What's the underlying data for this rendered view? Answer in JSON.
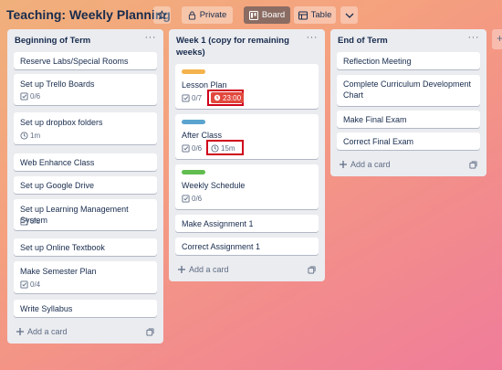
{
  "board": {
    "title": "Teaching: Weekly Planning",
    "visibility": "Private",
    "views": [
      {
        "label": "Board"
      },
      {
        "label": "Table"
      }
    ]
  },
  "lists": [
    {
      "title": "Beginning of Term",
      "cards": [
        {
          "title": "Reserve Labs/Special Rooms"
        },
        {
          "title": "Set up Trello Boards",
          "checklist": "0/6"
        },
        {
          "title": "Set up dropbox folders",
          "time": "1m"
        },
        {
          "title": "Web Enhance Class"
        },
        {
          "title": "Set up Google Drive"
        },
        {
          "title": "Set up Learning Management System",
          "checklist": "0/3"
        },
        {
          "title": "Set up Online Textbook"
        },
        {
          "title": "Make Semester Plan",
          "checklist": "0/4"
        },
        {
          "title": "Write Syllabus"
        }
      ],
      "add_label": "Add a card"
    },
    {
      "title": "Week 1 (copy for remaining weeks)",
      "cards": [
        {
          "title": "Lesson Plan",
          "label_color": "#f5b34d",
          "checklist": "0/7",
          "due": "23:00"
        },
        {
          "title": "After Class",
          "label_color": "#5ba4cf",
          "checklist": "0/6",
          "time": "15m"
        },
        {
          "title": "Weekly Schedule",
          "label_color": "#61bd4f",
          "checklist": "0/6"
        },
        {
          "title": "Make Assignment 1"
        },
        {
          "title": "Correct Assignment 1"
        }
      ],
      "add_label": "Add a card"
    },
    {
      "title": "End of Term",
      "cards": [
        {
          "title": "Reflection Meeting"
        },
        {
          "title": "Complete Curriculum Development Chart"
        },
        {
          "title": "Make Final Exam"
        },
        {
          "title": "Correct Final Exam"
        }
      ],
      "add_label": "Add a card"
    }
  ],
  "icons": {
    "star": "star-icon",
    "lock": "lock-icon",
    "board": "board-icon",
    "table": "table-icon",
    "chevron": "chevron-down-icon",
    "menu": "ellipsis-icon",
    "checklist": "checklist-icon",
    "clock": "clock-icon",
    "plus": "plus-icon",
    "template": "template-icon"
  },
  "colors": {
    "highlight": "#d0021b",
    "due_bg": "#e2483d",
    "board_button": "#8a6c63"
  }
}
